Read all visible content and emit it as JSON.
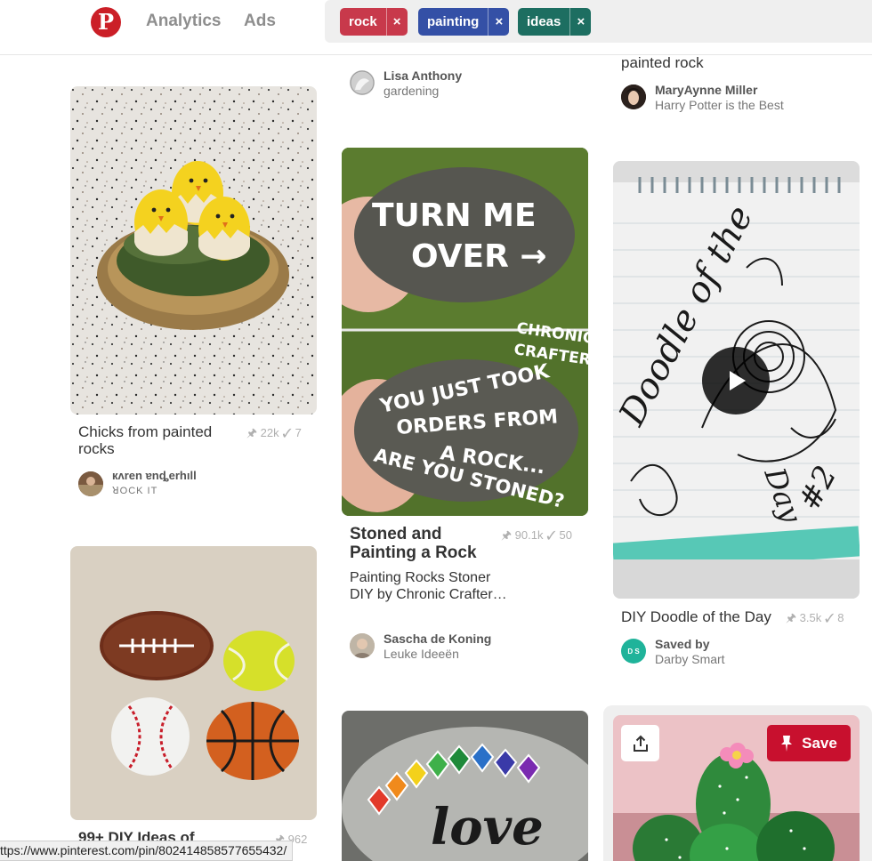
{
  "header": {
    "logo_letter": "P",
    "nav": [
      "Analytics",
      "Ads"
    ],
    "chips": [
      {
        "label": "rock",
        "color": "#c8394b"
      },
      {
        "label": "painting",
        "color": "#3450a6"
      },
      {
        "label": "ideas",
        "color": "#1d6e61"
      }
    ],
    "chip_close": "×"
  },
  "col2_top": {
    "user_name": "Lisa Anthony",
    "user_board": "gardening"
  },
  "col3_top": {
    "title_fragment": "painted rock",
    "user_name": "MaryAynne Miller",
    "user_board": "Harry Potter is the Best"
  },
  "pin_chicks": {
    "title": "Chicks from painted rocks",
    "saves": "22k",
    "tries": "7",
    "user_name": "кʌren ɐnȡerhıll",
    "user_board": "ꓤOCK IT"
  },
  "pin_stoned": {
    "image_text_top": [
      "TURN ME",
      "OVER →"
    ],
    "image_text_brand": [
      "CHRONIC",
      "CRAFTER"
    ],
    "image_text_bottom": [
      "YOU JUST TOOK",
      "ORDERS FROM",
      "A ROCK...",
      "ARE YOU STONED?"
    ],
    "title": "Stoned and Painting a Rock",
    "description": "Painting Rocks Stoner DIY by Chronic Crafter…",
    "saves": "90.1k",
    "tries": "50",
    "user_name": "Sascha de Koning",
    "user_board": "Leuke Ideeën"
  },
  "pin_doodle": {
    "image_text": [
      "Doodle of the",
      "Day",
      "#2"
    ],
    "title": "DIY Doodle of the Day",
    "saves": "3.5k",
    "tries": "8",
    "avatar_text": "D S",
    "user_name": "Saved by",
    "user_board": "Darby Smart"
  },
  "pin_sports": {
    "title": "99+ DIY Ideas of",
    "saves": "962"
  },
  "pin_love": {
    "image_text": "love"
  },
  "pin_cactus": {
    "save_label": "Save"
  },
  "statusbar": {
    "url": "ttps://www.pinterest.com/pin/802414858577655432/"
  },
  "icons": {
    "pin": "pin-icon",
    "check": "check-icon",
    "play": "play-icon",
    "share": "share-icon"
  }
}
